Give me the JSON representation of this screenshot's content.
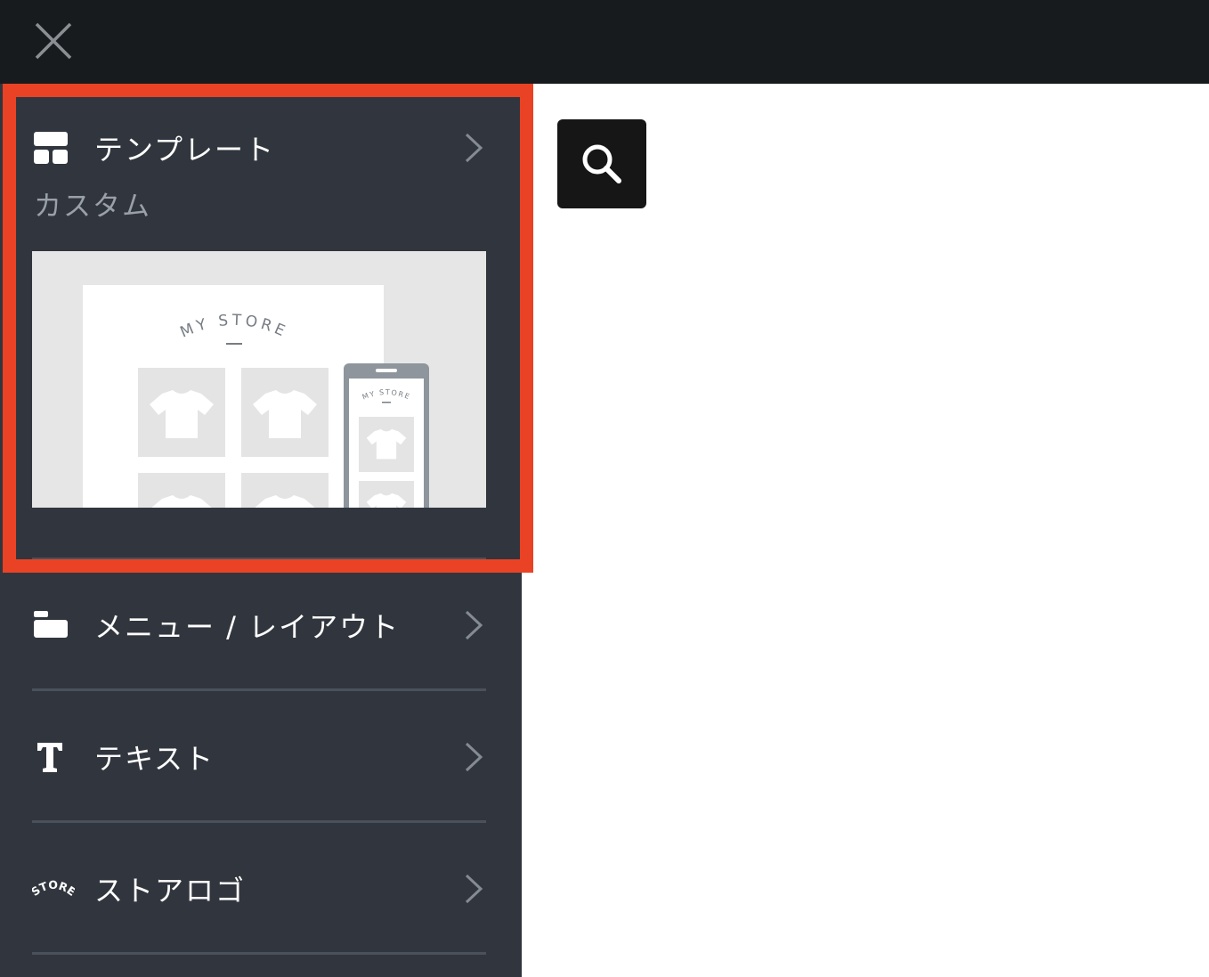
{
  "topbar": {
    "close_icon": "close-icon"
  },
  "highlight_color": "#ea4225",
  "sidebar": {
    "template": {
      "icon": "template-grid-icon",
      "label": "テンプレート",
      "current": "カスタム",
      "preview": {
        "store_title": "MY STORE",
        "phone_store_title": "MY STORE"
      }
    },
    "items": [
      {
        "icon": "menu-layout-icon",
        "label": "メニュー / レイアウト"
      },
      {
        "icon": "text-t-icon",
        "label": "テキスト"
      },
      {
        "icon": "store-logo-icon",
        "label": "ストアロゴ",
        "icon_text": "STORE"
      }
    ]
  },
  "search": {
    "icon": "search-icon"
  }
}
